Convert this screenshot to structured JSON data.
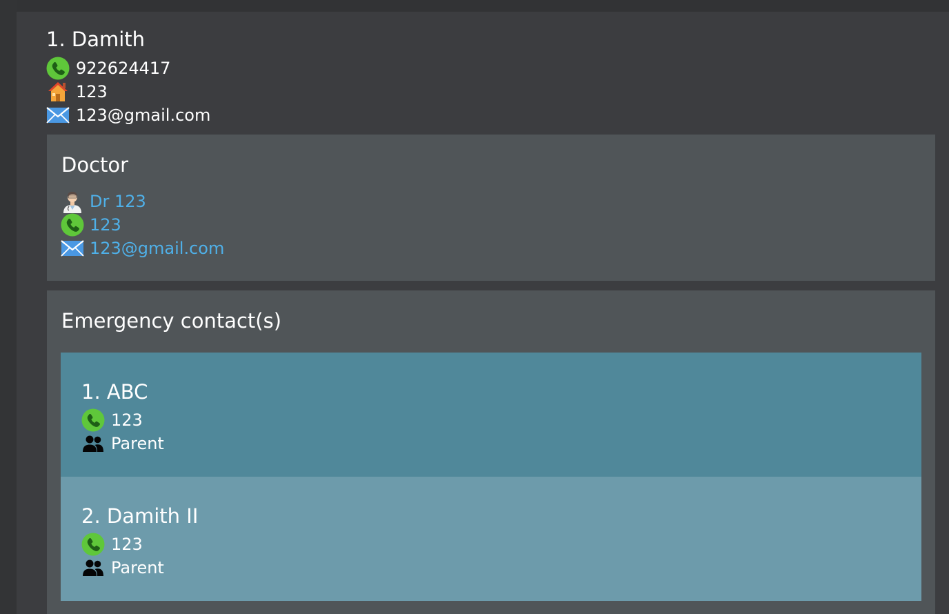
{
  "patient": {
    "name": "1. Damith",
    "phone": "922624417",
    "address": "123",
    "email": "123@gmail.com"
  },
  "doctor": {
    "heading": "Doctor",
    "name": "Dr 123",
    "phone": "123",
    "email": "123@gmail.com"
  },
  "emergency": {
    "heading": "Emergency contact(s)",
    "contacts": [
      {
        "name": "1. ABC",
        "phone": "123",
        "relationship": "Parent",
        "bg": "#50889a"
      },
      {
        "name": "2. Damith II",
        "phone": "123",
        "relationship": "Parent",
        "bg": "#6d9bab"
      }
    ]
  },
  "icons": {
    "phone": "phone-icon",
    "address": "house-icon",
    "email": "envelope-icon",
    "doctor": "doctor-avatar-icon",
    "relationship": "people-icon"
  },
  "colors": {
    "background": "#3c3d40",
    "section_bg": "#505558",
    "link": "#4fb0e8",
    "text": "#ffffff"
  }
}
